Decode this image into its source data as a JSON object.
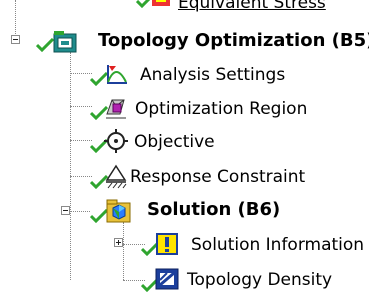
{
  "tree": {
    "top_partial": {
      "label": "Equivalent Stress",
      "icon": "equivalent-stress-icon"
    },
    "nodes": [
      {
        "id": "topology-optimization",
        "label": "Topology Optimization (B5)",
        "bold": true,
        "expanded": true,
        "icon": "topology-optimization-folder-icon",
        "status": "check"
      },
      {
        "id": "analysis-settings",
        "label": "Analysis Settings",
        "bold": false,
        "icon": "analysis-settings-icon",
        "status": "check"
      },
      {
        "id": "optimization-region",
        "label": "Optimization Region",
        "bold": false,
        "icon": "optimization-region-icon",
        "status": "check"
      },
      {
        "id": "objective",
        "label": "Objective",
        "bold": false,
        "icon": "objective-icon",
        "status": "check"
      },
      {
        "id": "response-constraint",
        "label": "Response Constraint",
        "bold": false,
        "icon": "response-constraint-icon",
        "status": "check"
      },
      {
        "id": "solution",
        "label": "Solution (B6)",
        "bold": true,
        "expanded": true,
        "icon": "solution-folder-icon",
        "status": "check"
      },
      {
        "id": "solution-information",
        "label": "Solution Information",
        "bold": false,
        "expanded": false,
        "icon": "solution-information-icon",
        "status": "check"
      },
      {
        "id": "topology-density",
        "label": "Topology Density",
        "bold": false,
        "icon": "topology-density-icon",
        "status": "check"
      }
    ]
  },
  "colors": {
    "check": "#2fa52f",
    "folder": "#e8c23a",
    "teal": "#1f8c8c",
    "blue": "#1c3f9c",
    "yellow": "#ffe400"
  }
}
